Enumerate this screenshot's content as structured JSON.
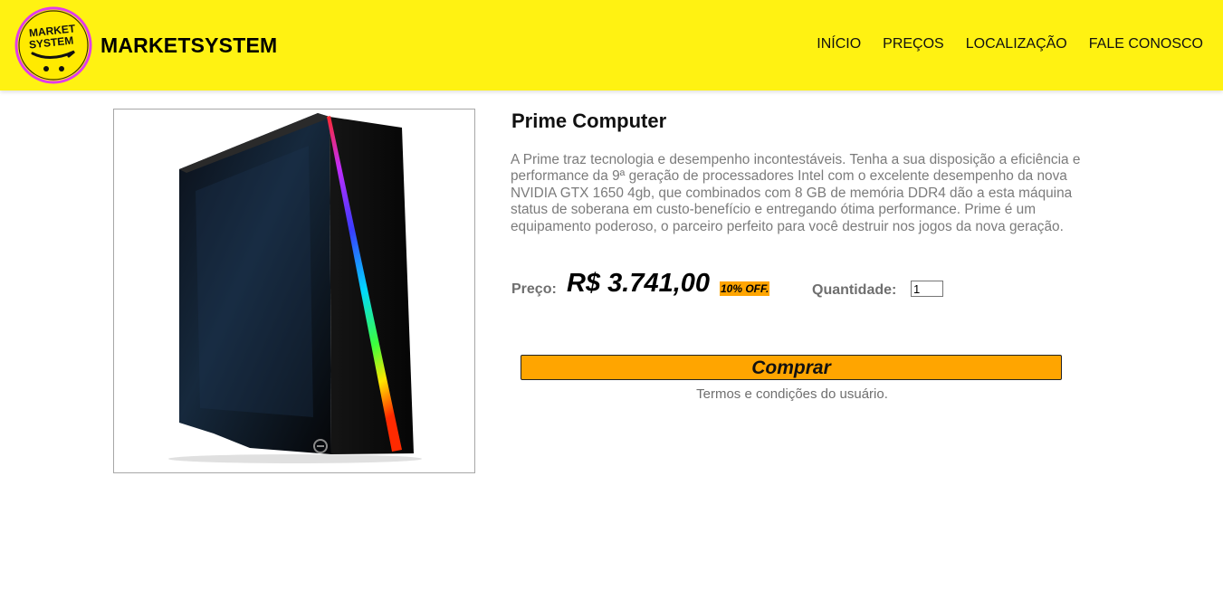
{
  "header": {
    "logo": {
      "line1": "MARKET",
      "line2": "SYSTEM",
      "ring_color": "#e13bea",
      "icon": "shopping-cart-logo"
    },
    "brand": "MARKETSYSTEM",
    "bg_color": "#fff212",
    "nav": [
      "INÍCIO",
      "PREÇOS",
      "LOCALIZAÇÃO",
      "FALE CONOSCO"
    ]
  },
  "product": {
    "image_subject": "pc-tower-case",
    "title": "Prime Computer",
    "description": "A Prime traz tecnologia e desempenho incontestáveis. Tenha a sua disposição a eficiência e performance da 9ª geração de processadores Intel com o excelente desempenho da nova NVIDIA GTX 1650 4gb, que combinados com 8 GB de memória DDR4 dão a esta máquina status de soberana em custo-benefício e entregando ótima performance. Prime é um equipamento poderoso, o parceiro perfeito para você destruir nos jogos da nova geração.",
    "price_label": "Preço:",
    "price": "R$ 3.741,00",
    "discount": "10% OFF.",
    "quantity_label": "Quantidade:",
    "quantity_value": "1",
    "buy_label": "Comprar",
    "terms": "Termos e condições do usuário.",
    "accent_color": "#ffa500"
  }
}
